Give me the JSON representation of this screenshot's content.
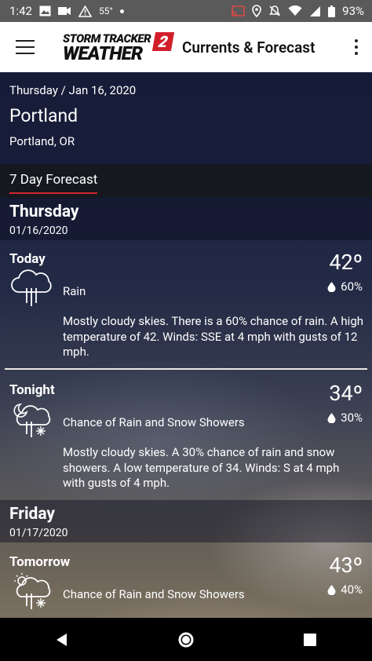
{
  "status_bar": {
    "time": "1:42",
    "temp": "55°",
    "battery": "93%"
  },
  "app_bar": {
    "logo_line1": "STORM TRACKER",
    "logo_line2": "WEATHER",
    "logo_number": "2",
    "title": "Currents & Forecast"
  },
  "header": {
    "date": "Thursday / Jan 16, 2020",
    "city": "Portland",
    "region": "Portland, OR"
  },
  "tabs": {
    "active_label": "7 Day Forecast"
  },
  "days": [
    {
      "name": "Thursday",
      "date": "01/16/2020",
      "periods": [
        {
          "name": "Today",
          "icon": "rain-icon",
          "temp": "42º",
          "precip": "60%",
          "condition": "Rain",
          "description": "Mostly cloudy skies. There is a 60% chance of rain. A high temperature of 42. Winds: SSE at 4 mph with gusts of 12 mph."
        },
        {
          "name": "Tonight",
          "icon": "night-rain-snow-icon",
          "temp": "34º",
          "precip": "30%",
          "condition": "Chance of Rain and Snow Showers",
          "description": "Mostly cloudy skies.  A 30% chance of rain and snow showers.  A low temperature of 34.  Winds: S at 4 mph with gusts of 4 mph."
        }
      ]
    },
    {
      "name": "Friday",
      "date": "01/17/2020",
      "periods": [
        {
          "name": "Tomorrow",
          "icon": "day-rain-snow-icon",
          "temp": "43º",
          "precip": "40%",
          "condition": "Chance of Rain and Snow Showers"
        }
      ]
    }
  ],
  "colors": {
    "tab_indicator": "#d2272e",
    "logo_red": "#d21f2a",
    "status_bar_bg": "#5a5a5a"
  }
}
